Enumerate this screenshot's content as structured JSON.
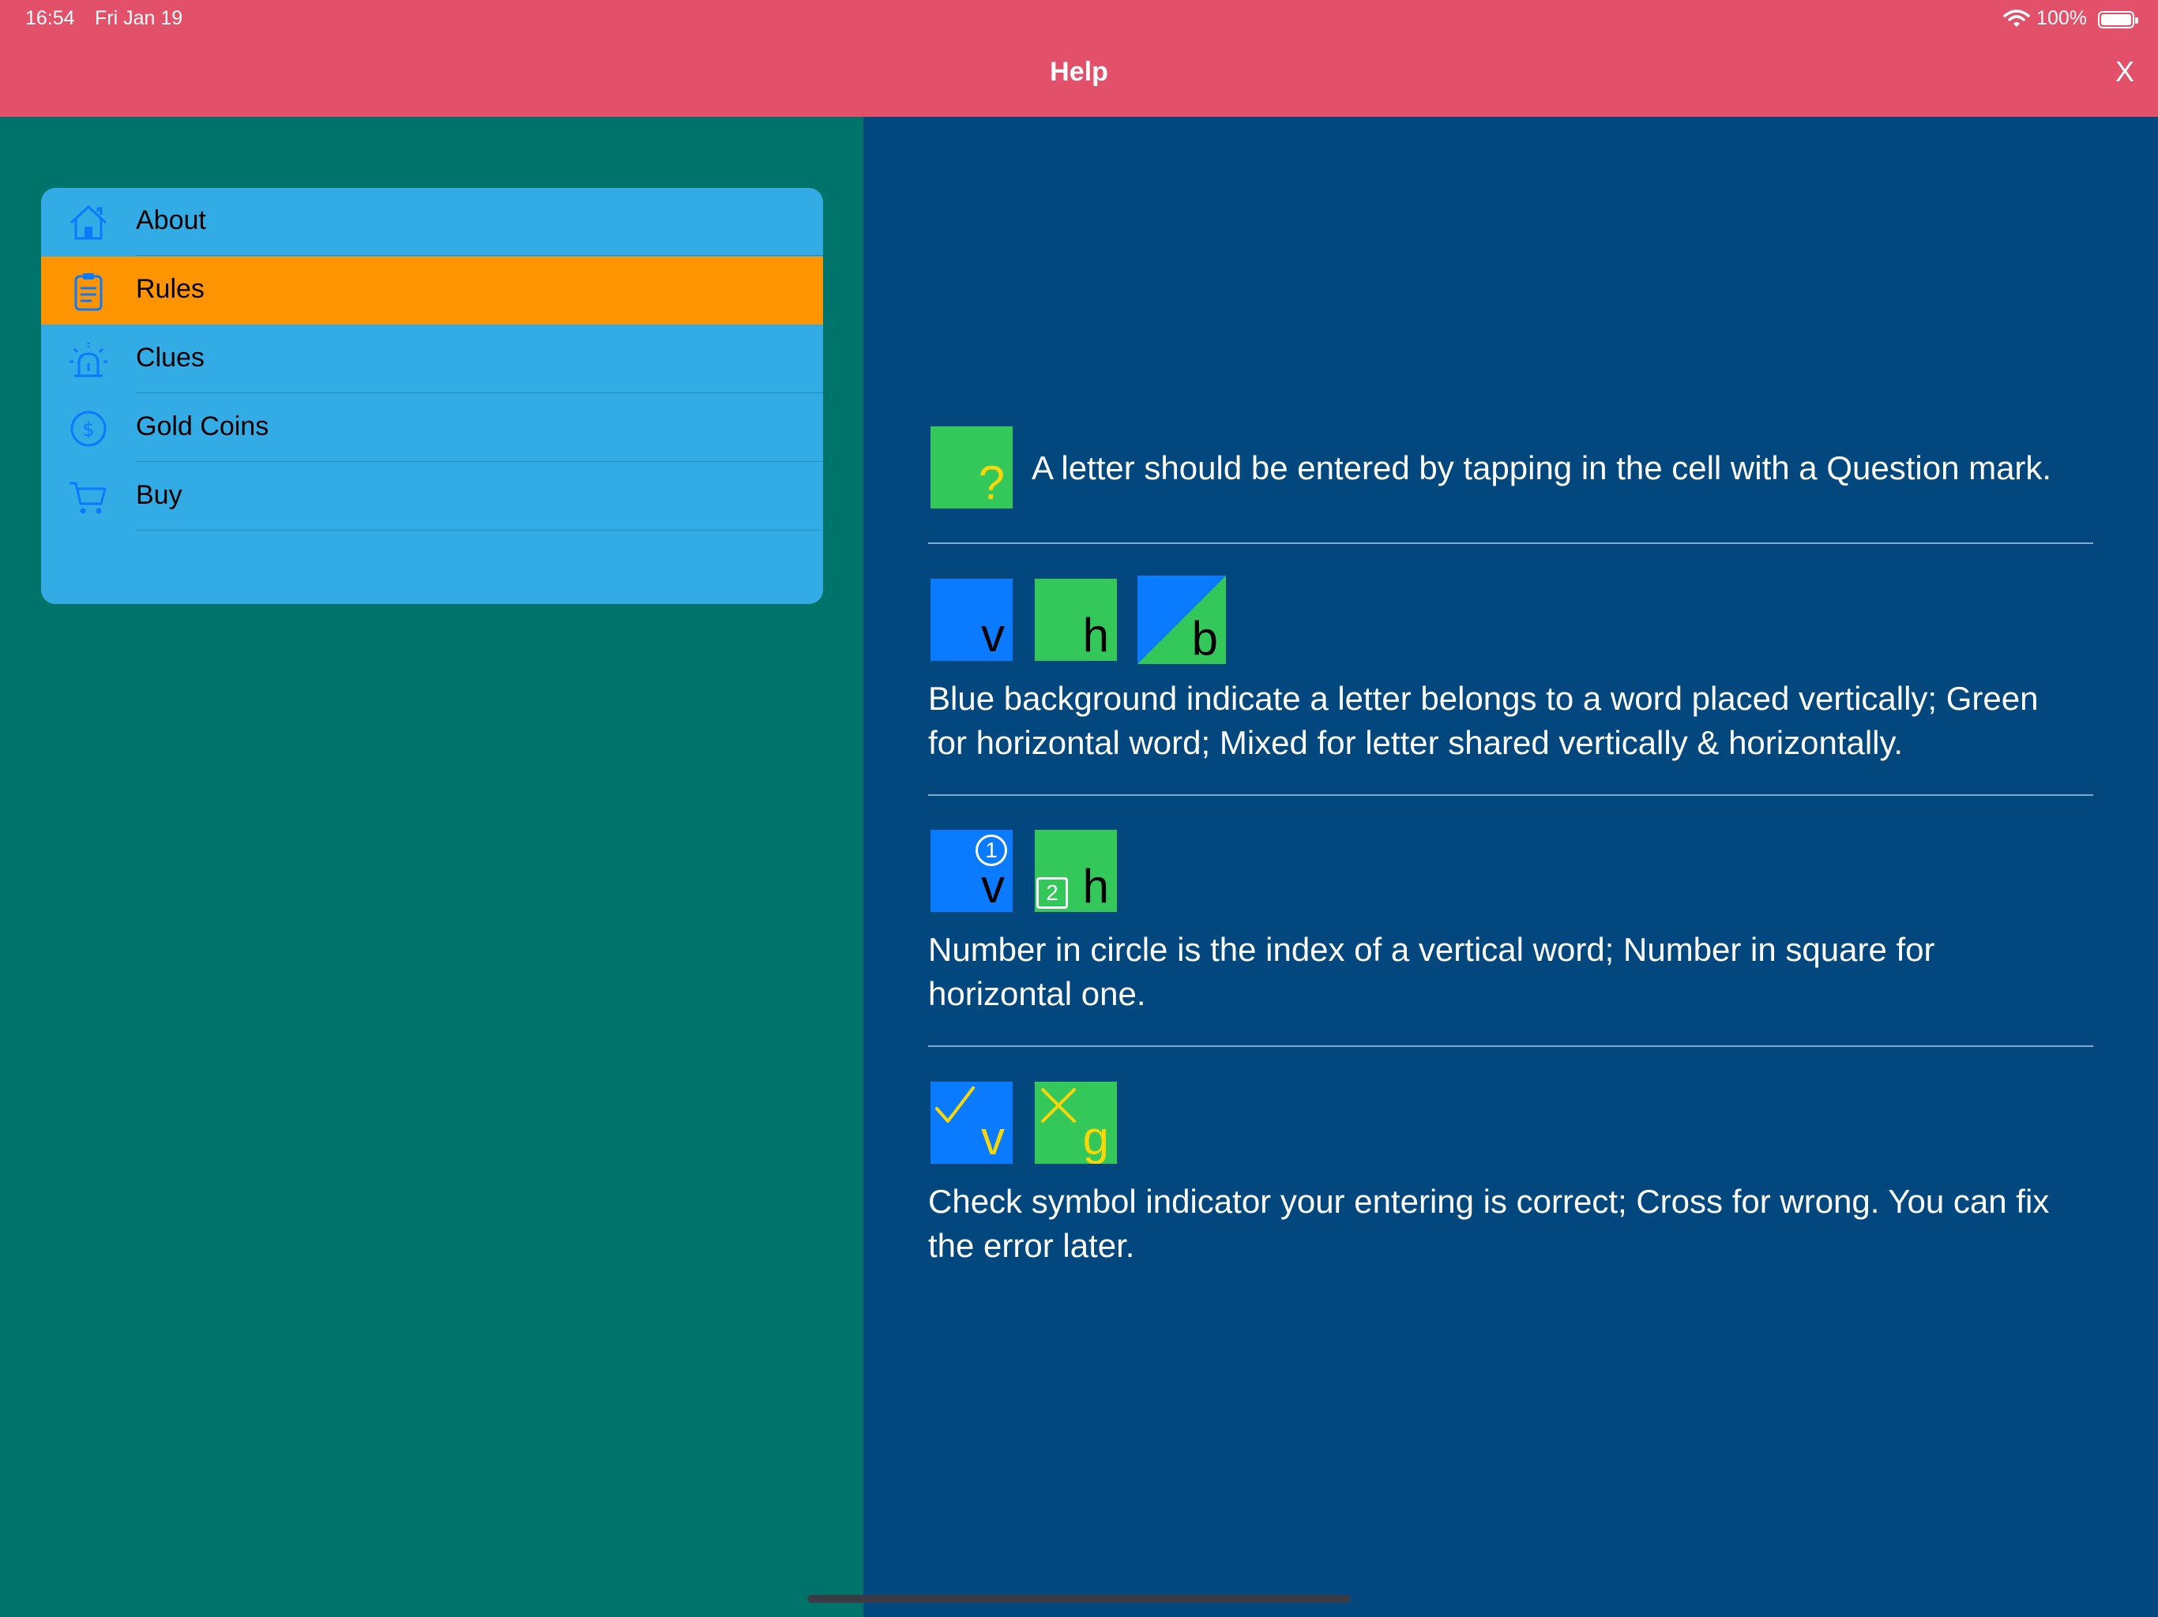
{
  "status": {
    "time": "16:54",
    "date": "Fri Jan 19",
    "battery": "100%"
  },
  "nav": {
    "title": "Help",
    "close": "X"
  },
  "colors": {
    "nav_bar": "#E2506A",
    "left_pane": "#00736A",
    "right_pane": "#02487F",
    "menu_card": "#33ACE5",
    "selected": "#FE9500",
    "cell_blue": "#0A7AFF",
    "cell_green": "#34C759",
    "indicator_yellow": "#F7D70A"
  },
  "menu": {
    "items": [
      {
        "label": "About",
        "icon": "house-icon",
        "selected": false
      },
      {
        "label": "Rules",
        "icon": "clipboard-icon",
        "selected": true
      },
      {
        "label": "Clues",
        "icon": "alarm-light-icon",
        "selected": false
      },
      {
        "label": "Gold Coins",
        "icon": "dollar-circle-icon",
        "selected": false
      },
      {
        "label": "Buy",
        "icon": "cart-icon",
        "selected": false
      }
    ]
  },
  "rules": {
    "r1": {
      "cell_char": "?",
      "text": "A letter should be entered by tapping in the cell with a Question mark."
    },
    "r2": {
      "cells": [
        "v",
        "h",
        "b"
      ],
      "text": "Blue background indicate a letter belongs to a word placed vertically; Green for horizontal word; Mixed for letter shared  vertically & horizontally."
    },
    "r3": {
      "cells": [
        "v",
        "h"
      ],
      "circle_index": "1",
      "square_index": "2",
      "text": "Number in circle is the index of a vertical word; Number in square for horizontal one."
    },
    "r4": {
      "cells": [
        "v",
        "g"
      ],
      "text": "Check symbol indicator your entering is correct; Cross for wrong. You can fix the error later."
    }
  }
}
